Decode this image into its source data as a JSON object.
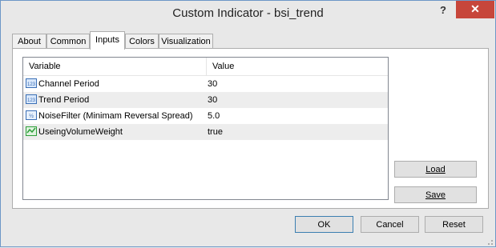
{
  "window": {
    "title": "Custom Indicator - bsi_trend",
    "help_label": "?",
    "close_label": "✕"
  },
  "tabs": [
    {
      "label": "About"
    },
    {
      "label": "Common"
    },
    {
      "label": "Inputs"
    },
    {
      "label": "Colors"
    },
    {
      "label": "Visualization"
    }
  ],
  "active_tab": "Inputs",
  "grid": {
    "headers": {
      "variable": "Variable",
      "value": "Value"
    },
    "rows": [
      {
        "variable": "Channel Period",
        "value": "30",
        "icon": "integer-icon"
      },
      {
        "variable": "Trend Period",
        "value": "30",
        "icon": "integer-icon"
      },
      {
        "variable": "NoiseFilter (Minimam Reversal Spread)",
        "value": "5.0",
        "icon": "double-icon"
      },
      {
        "variable": "UseingVolumeWeight",
        "value": "true",
        "icon": "boolean-icon"
      }
    ]
  },
  "buttons": {
    "load": "Load",
    "save": "Save",
    "ok": "OK",
    "cancel": "Cancel",
    "reset": "Reset"
  },
  "colors": {
    "close": "#c7463b",
    "int_icon": "#3b6fb6",
    "bool_icon": "#2e9e3a"
  }
}
